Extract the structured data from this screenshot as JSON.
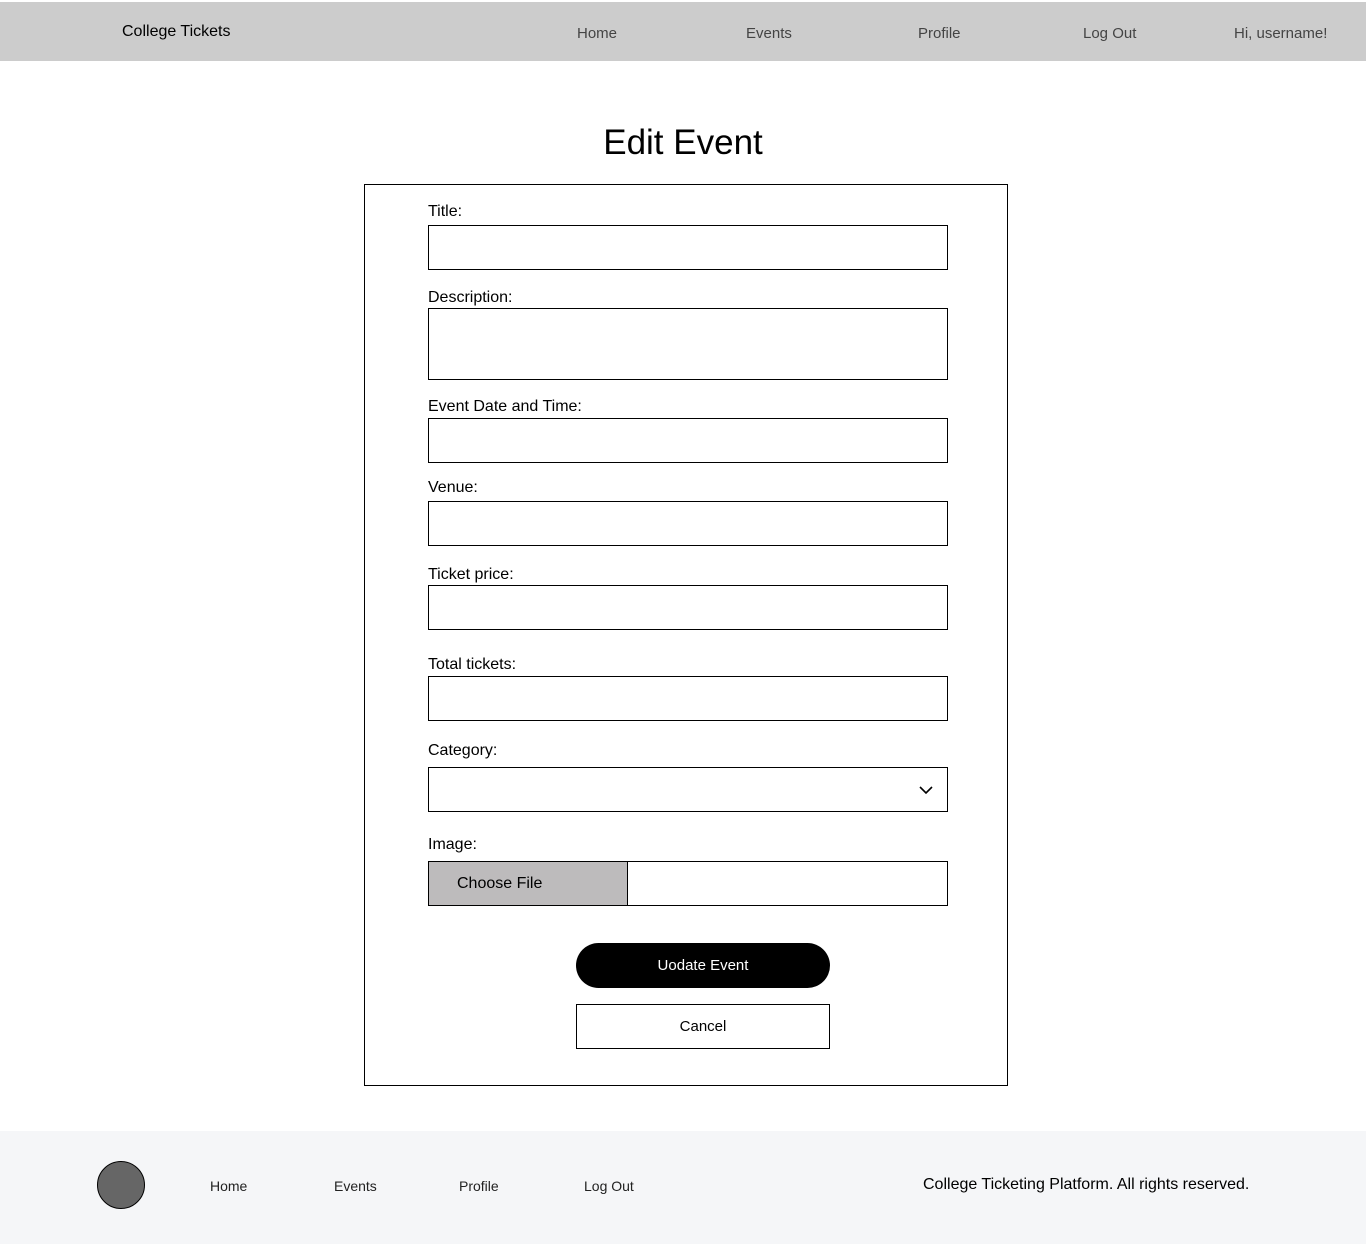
{
  "header": {
    "brand": "College Tickets",
    "nav": [
      "Home",
      "Events",
      "Profile",
      "Log Out"
    ],
    "greeting": "Hi, username!"
  },
  "page": {
    "title": "Edit Event"
  },
  "form": {
    "title_label": "Title:",
    "description_label": "Description:",
    "datetime_label": "Event Date and Time:",
    "venue_label": "Venue:",
    "price_label": "Ticket price:",
    "tickets_label": "Total tickets:",
    "category_label": "Category:",
    "category_value": "",
    "image_label": "Image:",
    "choose_file": "Choose File",
    "file_name": "",
    "submit": "Uodate Event",
    "cancel": "Cancel"
  },
  "footer": {
    "nav": [
      "Home",
      "Events",
      "Profile",
      "Log Out"
    ],
    "copyright": "College Ticketing Platform. All rights reserved."
  },
  "icons": {
    "category": "chevron-down-icon",
    "footer_logo": "logo-circle-icon"
  }
}
